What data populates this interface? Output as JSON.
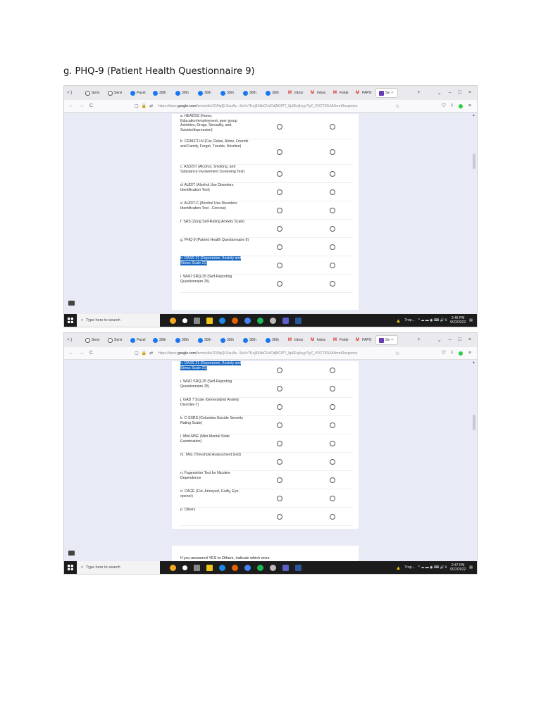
{
  "heading": "g. PHQ-9 (Patient Health Questionnaire 9)",
  "browser": {
    "nav_glyph": "< }",
    "tabs": [
      {
        "label": "Servi",
        "icon": "circle-info-icon"
      },
      {
        "label": "Servi",
        "icon": "circle-info-icon"
      },
      {
        "label": "Pacel",
        "icon": "facebook-icon"
      },
      {
        "label": "30th",
        "icon": "facebook-icon"
      },
      {
        "label": "30th",
        "icon": "facebook-icon"
      },
      {
        "label": "30th",
        "icon": "facebook-icon"
      },
      {
        "label": "30th",
        "icon": "facebook-icon"
      },
      {
        "label": "30th",
        "icon": "facebook-icon"
      },
      {
        "label": "30th",
        "icon": "facebook-icon"
      },
      {
        "label": "Inbox",
        "icon": "gmail-icon"
      },
      {
        "label": "Inbox",
        "icon": "gmail-icon"
      },
      {
        "label": "Folde",
        "icon": "gmail-icon"
      },
      {
        "label": "PAPO",
        "icon": "gmail-icon"
      }
    ],
    "active_tab": "Se",
    "active_tab_close": "×",
    "tab_controls": [
      "+",
      "⌄",
      "–",
      "□",
      "×"
    ],
    "nav_buttons": [
      "←",
      "→",
      "C"
    ],
    "security_glyphs": [
      "▢",
      "🔒",
      "⇄"
    ],
    "url_prefix": "https://docs.",
    "url_domain": "google.com",
    "url_rest": "/forms/d/e/1FAIpQLSeuAz...SeVc7fLxj9XkbGVdCdjNCIPT_8p0Eq4oyy7fyZ_VOCTKN.lA/formResponse",
    "star": "☆",
    "right_glyphs": [
      "⛉",
      "⭳",
      "≡"
    ]
  },
  "form": {
    "screen1_rows": [
      {
        "label": "a. HEADSS (Home, Education/employment, peer group Activities, Drugs, Sexuality, and, Suicide/depression)",
        "highlighted": false
      },
      {
        "label": "b. CRAFFT+N (Car, Relax, Alone, Friends and Family, Forget, Trouble, Nicotine)",
        "highlighted": false
      },
      {
        "label": "c. ASSIST (Alcohol, Smoking, and Substance Involvement Screening Test)",
        "highlighted": false
      },
      {
        "label": "d. AUDIT (Alcohol Use Disorders Identification Test)",
        "highlighted": false
      },
      {
        "label": "e. AUDIT-C (Alcohol Use Disorders Identification Test - Concise)",
        "highlighted": false
      },
      {
        "label": "f. SAS (Zung Self-Rating Anxiety Scale)",
        "highlighted": false
      },
      {
        "label": "g. PHQ-9 (Patient Health Questionnaire 9)",
        "highlighted": false
      },
      {
        "label": "h. DASS 21 (Depression, Anxiety and Stress Scale 21)",
        "highlighted": true
      },
      {
        "label": "i. WHO SRQ-25 (Self-Reporting Questionnaire 25)",
        "highlighted": false
      }
    ],
    "screen2_rows": [
      {
        "label": "h. DASS 21 (Depression, Anxiety and Stress Scale 21)",
        "highlighted": true
      },
      {
        "label": "i. WHO SRQ-25 (Self-Reporting Questionnaire 25)",
        "highlighted": false
      },
      {
        "label": "j. GAD 7 Scale (Generalized Anxiety Disorder-7)",
        "highlighted": false
      },
      {
        "label": "k. C-SSRS (Columbia-Suicide Severity Rating Scale)",
        "highlighted": false
      },
      {
        "label": "l. Mini-MSE (Mini-Mental State Examination)",
        "highlighted": false
      },
      {
        "label": "m. TAG (Threshold Assessment Grid)",
        "highlighted": false
      },
      {
        "label": "n. Fagerström Test for Nicotine Dependence",
        "highlighted": false
      },
      {
        "label": "o. CAGE (Cut, Annoyed, Guilty, Eye-opener)",
        "highlighted": false
      },
      {
        "label": "p. Others",
        "highlighted": false
      }
    ],
    "others_question": "If you answered YES to Others, indicate which ones"
  },
  "taskbar": {
    "search_placeholder": "Type here to search",
    "weather": "Trop...",
    "tray_glyphs": "^ ☁ ▬ ◉ ⌨ 🔊 ℹ",
    "screen1_time": "2:46 PM",
    "screen2_time": "2:47 PM",
    "date": "9/22/2022"
  },
  "colors": {
    "page_bg": "#e8eaf6",
    "highlight": "#1565c0",
    "form_accent": "#673ab7",
    "taskbar": "#1c1c1c"
  }
}
